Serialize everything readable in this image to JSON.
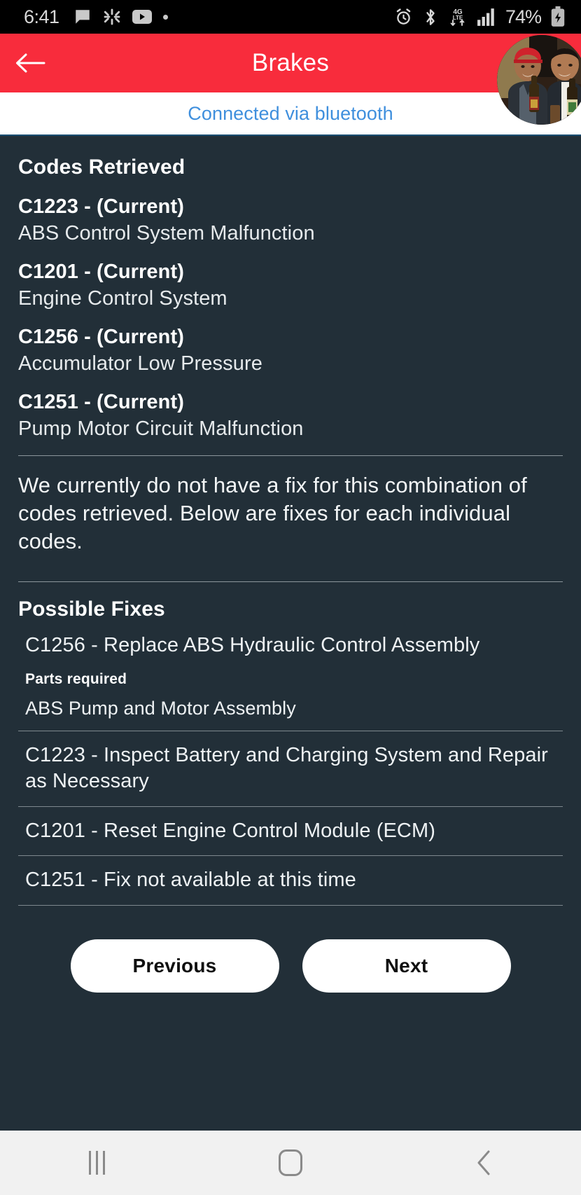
{
  "status_bar": {
    "time": "6:41",
    "left_icons": [
      "message-icon",
      "yelp-icon",
      "youtube-icon",
      "dot-icon"
    ],
    "right_icons": [
      "alarm-icon",
      "bluetooth-icon",
      "4g-lte-icon",
      "signal-icon"
    ],
    "network_label": "4G LTE",
    "battery_percent": "74%",
    "battery_state": "charging",
    "background_color": "#000000"
  },
  "header": {
    "title": "Brakes",
    "back_icon": "back-arrow-icon",
    "avatar_label": "profile-avatar",
    "background_color": "#f82c3c"
  },
  "connection": {
    "status_text": "Connected via bluetooth",
    "text_color": "#3f8fdd",
    "background_color": "#ffffff"
  },
  "codes_section": {
    "title": "Codes Retrieved",
    "codes": [
      {
        "header": "C1223 - (Current)",
        "description": "ABS Control System Malfunction"
      },
      {
        "header": "C1201 - (Current)",
        "description": "Engine Control System"
      },
      {
        "header": "C1256 - (Current)",
        "description": "Accumulator Low Pressure"
      },
      {
        "header": "C1251 - (Current)",
        "description": "Pump Motor Circuit Malfunction"
      }
    ]
  },
  "notice": {
    "text": "We currently do not have a fix for this combination of codes retrieved. Below are fixes for each individual codes."
  },
  "fixes_section": {
    "title": "Possible Fixes",
    "fixes": [
      {
        "text": "C1256 - Replace ABS Hydraulic Control Assembly",
        "parts_label": "Parts required",
        "parts_value": "ABS Pump and Motor Assembly"
      },
      {
        "text": "C1223 - Inspect Battery and Charging System and Repair as Necessary"
      },
      {
        "text": "C1201 - Reset Engine Control Module (ECM)"
      },
      {
        "text": "C1251 - Fix not available at this time"
      }
    ]
  },
  "footer_buttons": {
    "previous_label": "Previous",
    "next_label": "Next"
  },
  "nav_bar": {
    "recents_icon": "recents-icon",
    "home_icon": "home-icon",
    "back_icon": "back-chevron-icon",
    "background_color": "#f1f1f1"
  },
  "theme": {
    "page_background": "#222f38",
    "accent_red": "#f82c3c",
    "link_blue": "#3f8fdd"
  }
}
